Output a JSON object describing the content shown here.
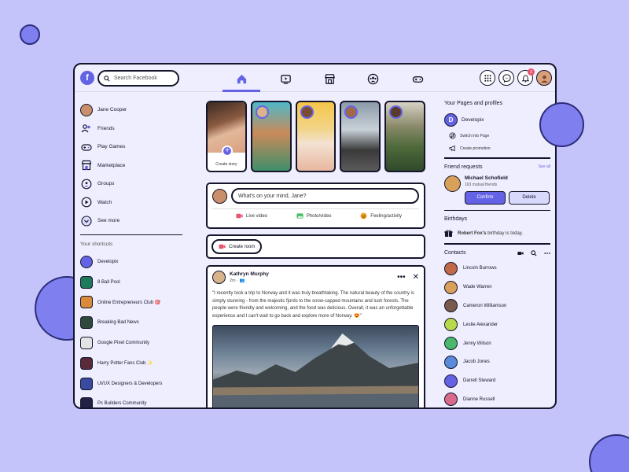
{
  "topbar": {
    "logo_letter": "f",
    "search_placeholder": "Search Facebook",
    "nav_icons": [
      "home-icon",
      "watch-icon",
      "marketplace-icon",
      "groups-icon",
      "gaming-icon"
    ],
    "notification_count": "2"
  },
  "left": {
    "profile_name": "Jane Cooper",
    "menu": [
      {
        "label": "Friends",
        "icon": "friends-icon"
      },
      {
        "label": "Play Games",
        "icon": "gamepad-icon"
      },
      {
        "label": "Marketplace",
        "icon": "store-icon"
      },
      {
        "label": "Groups",
        "icon": "groups-icon"
      },
      {
        "label": "Watch",
        "icon": "watch-icon"
      },
      {
        "label": "See more",
        "icon": "chevron-down-icon"
      }
    ],
    "shortcuts_title": "Your shortcuts",
    "shortcuts": [
      {
        "label": "Developix",
        "color": "#6463e6"
      },
      {
        "label": "8 Ball Pool",
        "color": "#1e7a5a"
      },
      {
        "label": "Online Entrepreneurs Club 🎯",
        "color": "#d98b3a"
      },
      {
        "label": "Breaking Bad News",
        "color": "#2f4a3a"
      },
      {
        "label": "Google Pixel Community",
        "color": "#e3e3e3"
      },
      {
        "label": "Harry Potter Fans Club ✨",
        "color": "#5a2a3a"
      },
      {
        "label": "UI/UX Designers & Developers",
        "color": "#3a4aa0"
      },
      {
        "label": "Pc Builders Community",
        "color": "#222244"
      }
    ]
  },
  "center": {
    "create_story_label": "Create story",
    "composer_placeholder": "What's on your mind, Jane?",
    "actions": [
      {
        "label": "Live video",
        "icon": "live-video-icon",
        "color": "#e8556e"
      },
      {
        "label": "Photo/video",
        "icon": "photo-icon",
        "color": "#45bd62"
      },
      {
        "label": "Feeling/activity",
        "icon": "feeling-icon",
        "color": "#f5a623"
      }
    ],
    "create_room_label": "Create room",
    "post": {
      "author": "Kathryn Murphy",
      "time": "2m · ",
      "text": "\"I recently took a trip to Norway and it was truly breathtaking. The natural beauty of the country is simply stunning - from the majestic fjords to the snow-capped mountains and lush forests. The people were friendly and welcoming, and the food was delicious. Overall, it was an unforgettable experience and I can't wait to go back and explore more of Norway. 😍\""
    }
  },
  "right": {
    "pages_title": "Your Pages and profiles",
    "page_name": "Developix",
    "page_letter": "D",
    "switch_label": "Switch into Page",
    "promo_label": "Create promotion",
    "requests_title": "Friend requests",
    "see_all": "See all",
    "request_name": "Michael Schofield",
    "request_mutual": "163 mutual friends",
    "confirm_label": "Confirm",
    "delete_label": "Delete",
    "birthdays_title": "Birthdays",
    "birthday_name": "Robert Fox's",
    "birthday_rest": " birthday is today.",
    "contacts_title": "Contacts",
    "contacts": [
      {
        "name": "Lincoln Burrows",
        "color": "#c06a4a"
      },
      {
        "name": "Wade Warren",
        "color": "#d9a05a"
      },
      {
        "name": "Cameron Williamson",
        "color": "#7a5a4a"
      },
      {
        "name": "Leslie Alexander",
        "color": "#b8d94a"
      },
      {
        "name": "Jenny Wilson",
        "color": "#4ab86a"
      },
      {
        "name": "Jacob Jones",
        "color": "#5a8ad9"
      },
      {
        "name": "Darrell Steward",
        "color": "#6463e6"
      },
      {
        "name": "Dianne Russell",
        "color": "#d96a8a"
      }
    ]
  }
}
